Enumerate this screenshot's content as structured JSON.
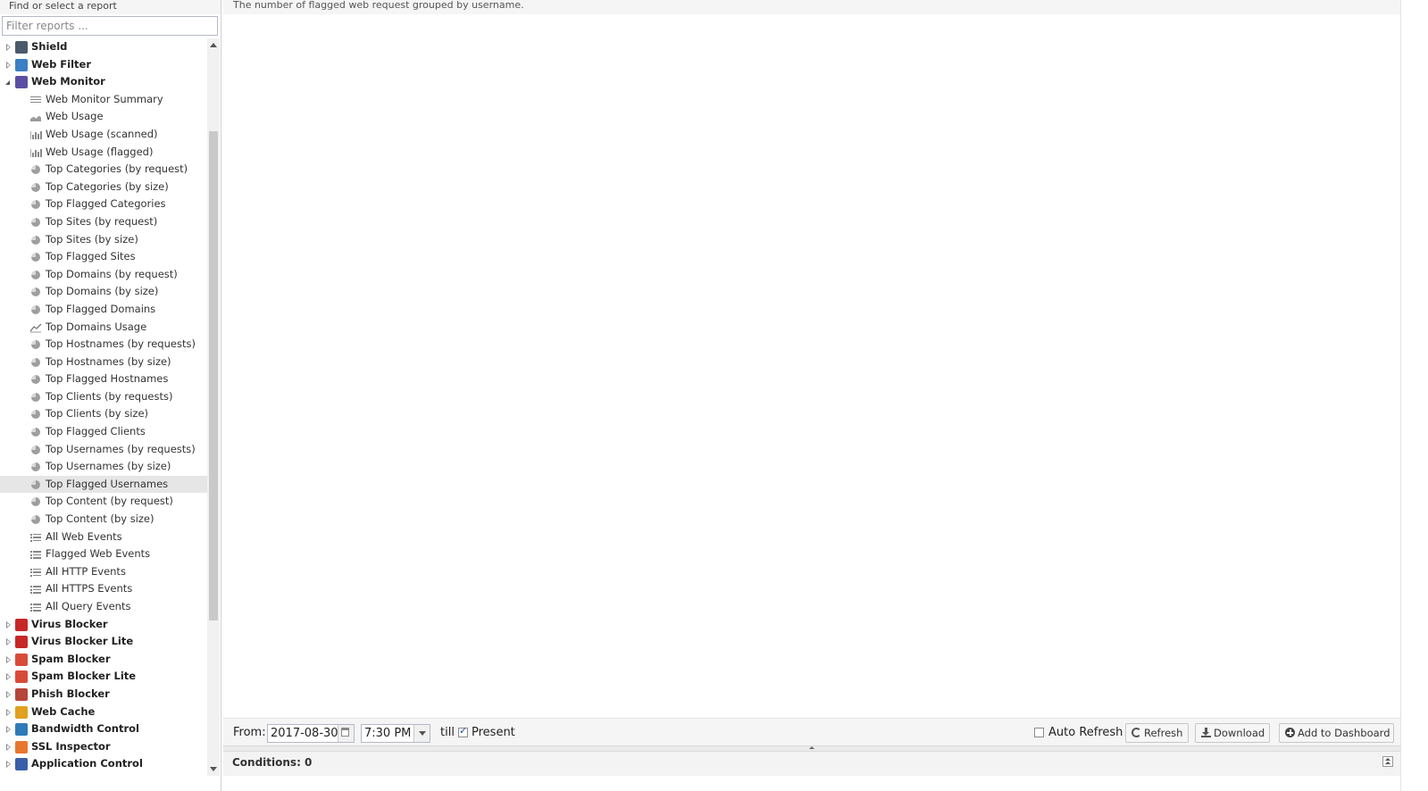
{
  "left_panel": {
    "title": "Find or select a report",
    "filter_placeholder": "Filter reports ...",
    "tree": [
      {
        "type": "category",
        "label": "Shield",
        "expanded": false,
        "icon": "shield-icon",
        "color": "#4a5a6b"
      },
      {
        "type": "category",
        "label": "Web Filter",
        "expanded": false,
        "icon": "web-filter-icon",
        "color": "#3b7fc4"
      },
      {
        "type": "category",
        "label": "Web Monitor",
        "expanded": true,
        "icon": "web-monitor-icon",
        "color": "#5b4fa3"
      },
      {
        "type": "report",
        "label": "Web Monitor Summary",
        "icon": "text-lines-icon"
      },
      {
        "type": "report",
        "label": "Web Usage",
        "icon": "area-chart-icon"
      },
      {
        "type": "report",
        "label": "Web Usage (scanned)",
        "icon": "bar-chart-icon"
      },
      {
        "type": "report",
        "label": "Web Usage (flagged)",
        "icon": "bar-chart-icon"
      },
      {
        "type": "report",
        "label": "Top Categories (by request)",
        "icon": "pie-chart-icon"
      },
      {
        "type": "report",
        "label": "Top Categories (by size)",
        "icon": "pie-chart-icon"
      },
      {
        "type": "report",
        "label": "Top Flagged Categories",
        "icon": "pie-chart-icon"
      },
      {
        "type": "report",
        "label": "Top Sites (by request)",
        "icon": "pie-chart-icon"
      },
      {
        "type": "report",
        "label": "Top Sites (by size)",
        "icon": "pie-chart-icon"
      },
      {
        "type": "report",
        "label": "Top Flagged Sites",
        "icon": "pie-chart-icon"
      },
      {
        "type": "report",
        "label": "Top Domains (by request)",
        "icon": "pie-chart-icon"
      },
      {
        "type": "report",
        "label": "Top Domains (by size)",
        "icon": "pie-chart-icon"
      },
      {
        "type": "report",
        "label": "Top Flagged Domains",
        "icon": "pie-chart-icon"
      },
      {
        "type": "report",
        "label": "Top Domains Usage",
        "icon": "line-chart-icon"
      },
      {
        "type": "report",
        "label": "Top Hostnames (by requests)",
        "icon": "pie-chart-icon"
      },
      {
        "type": "report",
        "label": "Top Hostnames (by size)",
        "icon": "pie-chart-icon"
      },
      {
        "type": "report",
        "label": "Top Flagged Hostnames",
        "icon": "pie-chart-icon"
      },
      {
        "type": "report",
        "label": "Top Clients (by requests)",
        "icon": "pie-chart-icon"
      },
      {
        "type": "report",
        "label": "Top Clients (by size)",
        "icon": "pie-chart-icon"
      },
      {
        "type": "report",
        "label": "Top Flagged Clients",
        "icon": "pie-chart-icon"
      },
      {
        "type": "report",
        "label": "Top Usernames (by requests)",
        "icon": "pie-chart-icon"
      },
      {
        "type": "report",
        "label": "Top Usernames (by size)",
        "icon": "pie-chart-icon"
      },
      {
        "type": "report",
        "label": "Top Flagged Usernames",
        "icon": "pie-chart-icon",
        "selected": true
      },
      {
        "type": "report",
        "label": "Top Content (by request)",
        "icon": "pie-chart-icon"
      },
      {
        "type": "report",
        "label": "Top Content (by size)",
        "icon": "pie-chart-icon"
      },
      {
        "type": "report",
        "label": "All Web Events",
        "icon": "list-icon"
      },
      {
        "type": "report",
        "label": "Flagged Web Events",
        "icon": "list-icon"
      },
      {
        "type": "report",
        "label": "All HTTP Events",
        "icon": "list-icon"
      },
      {
        "type": "report",
        "label": "All HTTPS Events",
        "icon": "list-icon"
      },
      {
        "type": "report",
        "label": "All Query Events",
        "icon": "list-icon"
      },
      {
        "type": "category",
        "label": "Virus Blocker",
        "expanded": false,
        "icon": "virus-blocker-icon",
        "color": "#c62828"
      },
      {
        "type": "category",
        "label": "Virus Blocker Lite",
        "expanded": false,
        "icon": "virus-blocker-lite-icon",
        "color": "#c62828"
      },
      {
        "type": "category",
        "label": "Spam Blocker",
        "expanded": false,
        "icon": "spam-blocker-icon",
        "color": "#d84b3a"
      },
      {
        "type": "category",
        "label": "Spam Blocker Lite",
        "expanded": false,
        "icon": "spam-blocker-lite-icon",
        "color": "#d84b3a"
      },
      {
        "type": "category",
        "label": "Phish Blocker",
        "expanded": false,
        "icon": "phish-blocker-icon",
        "color": "#b5443a"
      },
      {
        "type": "category",
        "label": "Web Cache",
        "expanded": false,
        "icon": "web-cache-icon",
        "color": "#e0a020"
      },
      {
        "type": "category",
        "label": "Bandwidth Control",
        "expanded": false,
        "icon": "bandwidth-control-icon",
        "color": "#2f7bb8"
      },
      {
        "type": "category",
        "label": "SSL Inspector",
        "expanded": false,
        "icon": "ssl-inspector-icon",
        "color": "#e8772e"
      },
      {
        "type": "category",
        "label": "Application Control",
        "expanded": false,
        "icon": "application-control-icon",
        "color": "#3a5fa8"
      }
    ]
  },
  "report": {
    "description": "The number of flagged web request grouped by username."
  },
  "toolbar": {
    "from_label": "From:",
    "from_date": "2017-08-30",
    "from_time": "7:30 PM",
    "till_label": "till",
    "present_label": "Present",
    "present_checked": true,
    "auto_refresh_label": "Auto Refresh",
    "auto_refresh_checked": false,
    "refresh_label": "Refresh",
    "download_label": "Download",
    "add_dashboard_label": "Add to Dashboard"
  },
  "conditions": {
    "label": "Conditions: 0"
  }
}
